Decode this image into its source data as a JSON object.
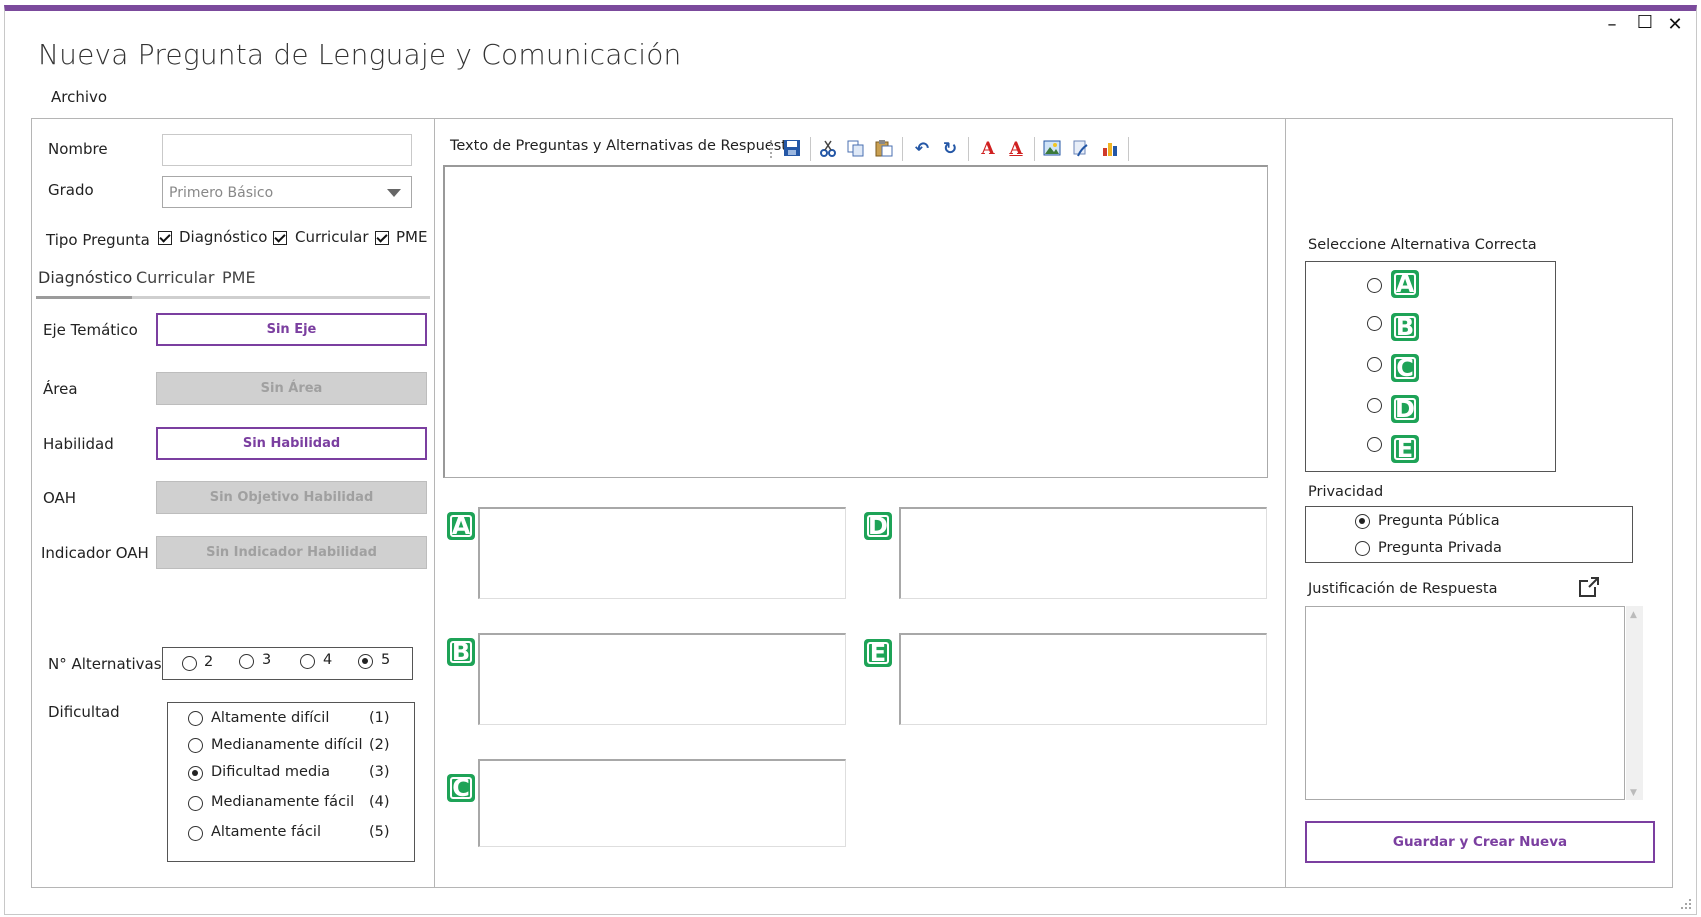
{
  "window": {
    "title": "Nueva Pregunta de Lenguaje y Comunicación",
    "minimize": "–",
    "maximize": "☐",
    "close": "✕"
  },
  "menu": {
    "archivo": "Archivo"
  },
  "left": {
    "nombre_label": "Nombre",
    "nombre_value": "",
    "grado_label": "Grado",
    "grado_value": "Primero Básico",
    "tipo_label": "Tipo Pregunta",
    "tipo_options": [
      "Diagnóstico",
      "Curricular",
      "PME"
    ],
    "tabs": [
      "Diagnóstico",
      "Curricular",
      "PME"
    ],
    "eje_label": "Eje Temático",
    "eje_button": "Sin Eje",
    "area_label": "Área",
    "area_button": "Sin Área",
    "habilidad_label": "Habilidad",
    "habilidad_button": "Sin Habilidad",
    "oah_label": "OAH",
    "oah_button": "Sin Objetivo Habilidad",
    "indicador_label": "Indicador OAH",
    "indicador_button": "Sin Indicador Habilidad",
    "nalt_label": "N° Alternativas",
    "nalt_options": [
      "2",
      "3",
      "4",
      "5"
    ],
    "nalt_selected": "5",
    "dificultad_label": "Dificultad",
    "dificultad_options": [
      {
        "label": "Altamente difícil",
        "level": "(1)"
      },
      {
        "label": "Medianamente difícil",
        "level": "(2)"
      },
      {
        "label": "Dificultad media",
        "level": "(3)"
      },
      {
        "label": "Medianamente fácil",
        "level": "(4)"
      },
      {
        "label": "Altamente fácil",
        "level": "(5)"
      }
    ],
    "dificultad_selected": "Dificultad media"
  },
  "center": {
    "toolbar_title": "Texto de Preguntas y Alternativas de Respuesta",
    "toolbar_icons": [
      "save-icon",
      "cut-icon",
      "copy-icon",
      "paste-icon",
      "undo-icon",
      "redo-icon",
      "font-color-icon",
      "highlight-color-icon",
      "insert-image-icon",
      "insert-formula-icon",
      "insert-chart-icon"
    ],
    "alternatives": [
      "A",
      "B",
      "C",
      "D",
      "E"
    ]
  },
  "right": {
    "correcta_label": "Seleccione Alternativa Correcta",
    "correcta_options": [
      "A",
      "B",
      "C",
      "D",
      "E"
    ],
    "privacidad_label": "Privacidad",
    "privacidad_options": [
      "Pregunta Pública",
      "Pregunta Privada"
    ],
    "privacidad_selected": "Pregunta Pública",
    "justificacion_label": "Justificación de Respuesta",
    "guardar_button": "Guardar y Crear Nueva"
  },
  "colors": {
    "accent": "#7b3fa0",
    "badge_green": "#1ea357",
    "disabled_gray": "#d0d0d0"
  }
}
